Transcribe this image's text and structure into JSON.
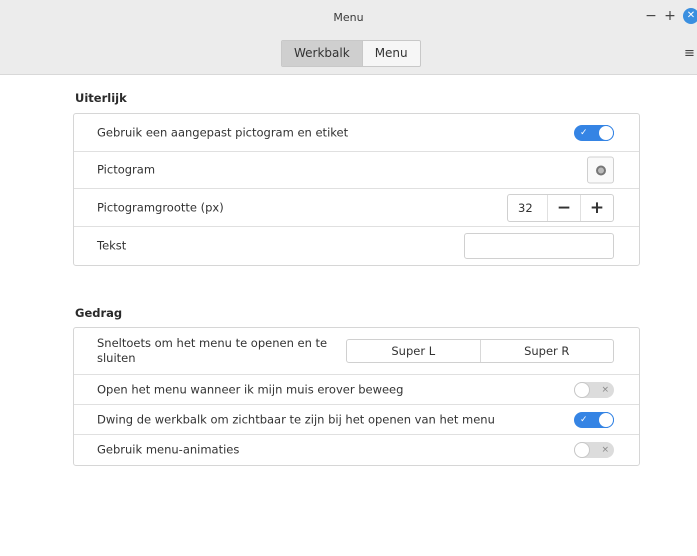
{
  "window": {
    "title": "Menu",
    "minimize": "−",
    "maximize": "+",
    "close": "✕"
  },
  "tabs": [
    {
      "label": "Werkbalk",
      "active": true
    },
    {
      "label": "Menu",
      "active": false
    }
  ],
  "menu_icon": "hamburger-menu-icon",
  "appearance": {
    "title": "Uiterlijk",
    "custom_icon_label": "Gebruik een aangepast pictogram en etiket",
    "custom_icon_enabled": true,
    "icon_label": "Pictogram",
    "icon_size_label": "Pictogramgrootte (px)",
    "icon_size_value": "32",
    "icon_size_decrement": "−",
    "icon_size_increment": "+",
    "text_label": "Tekst",
    "text_value": ""
  },
  "behavior": {
    "title": "Gedrag",
    "shortcut_label": "Sneltoets om het menu te openen en te sluiten",
    "shortcut_keys": [
      "Super L",
      "Super R"
    ],
    "hover_label": "Open het menu wanneer ik mijn muis erover beweeg",
    "hover_enabled": false,
    "force_panel_label": "Dwing de werkbalk om zichtbaar te zijn bij het openen van het menu",
    "force_panel_enabled": true,
    "animations_label": "Gebruik menu-animaties",
    "animations_enabled": false
  },
  "colors": {
    "accent": "#3584e4",
    "header_bg": "#ececec",
    "active_tab": "#cfcfcf"
  }
}
